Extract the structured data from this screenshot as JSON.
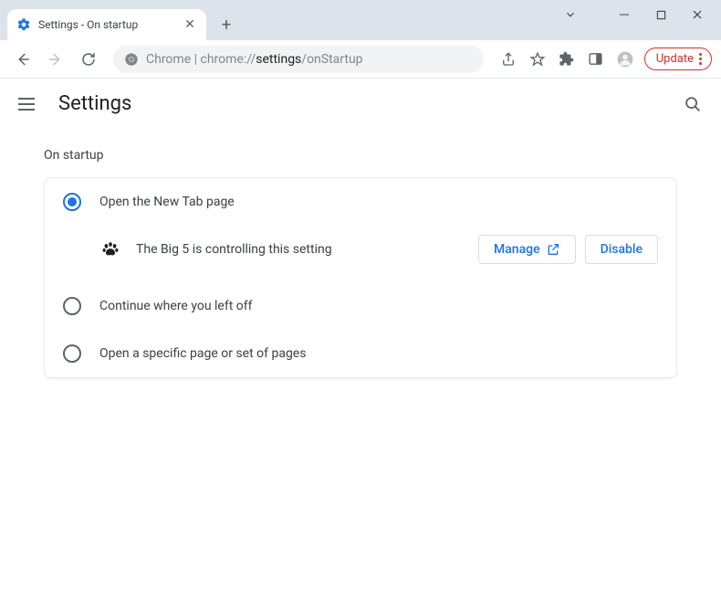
{
  "window": {
    "tab_title": "Settings - On startup"
  },
  "toolbar": {
    "url_prefix": "Chrome",
    "url_dim": "chrome://",
    "url_main": "settings",
    "url_tail": "/onStartup",
    "update_label": "Update"
  },
  "header": {
    "title": "Settings"
  },
  "section": {
    "label": "On startup",
    "options": [
      {
        "label": "Open the New Tab page"
      },
      {
        "label": "Continue where you left off"
      },
      {
        "label": "Open a specific page or set of pages"
      }
    ],
    "extension_notice": "The Big 5 is controlling this setting",
    "manage_label": "Manage",
    "disable_label": "Disable"
  }
}
